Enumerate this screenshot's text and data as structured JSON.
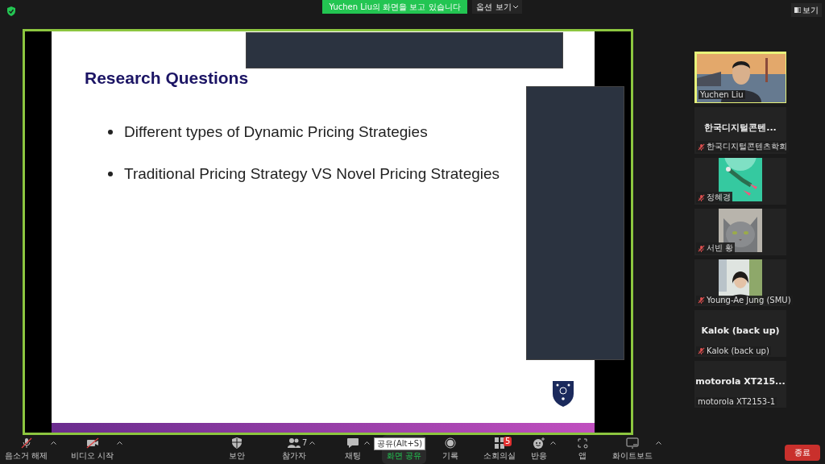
{
  "top_bar": {
    "sharing_banner": "Yuchen Liu의 화면을 보고 있습니다",
    "view_options": "옵션 보기",
    "view_button": "보기"
  },
  "shared_screen": {
    "slide": {
      "title": "Research Questions",
      "bullets": [
        "Different types of Dynamic Pricing Strategies",
        "Traditional Pricing Strategy VS Novel Pricing Strategies"
      ]
    }
  },
  "participants": [
    {
      "kind": "video",
      "name": "Yuchen Liu",
      "muted": false,
      "speaking": true
    },
    {
      "kind": "name",
      "display": "한국디지털콘텐...",
      "name": "한국디지털콘텐츠학회",
      "muted": true,
      "speaking": false
    },
    {
      "kind": "picture",
      "name": "정혜경",
      "muted": true,
      "speaking": false
    },
    {
      "kind": "picture",
      "name": "서빈 황",
      "muted": true,
      "speaking": false
    },
    {
      "kind": "picture",
      "name": "Young-Ae Jung (SMU)",
      "muted": true,
      "speaking": false
    },
    {
      "kind": "name",
      "display": "Kalok (back up)",
      "name": "Kalok (back up)",
      "muted": true,
      "speaking": false
    },
    {
      "kind": "name",
      "display": "motorola  XT215...",
      "name": "motorola XT2153-1",
      "muted": false,
      "speaking": false
    }
  ],
  "toolbar": [
    {
      "kind": "mic",
      "label": "음소거 해제",
      "off": true,
      "caret": true
    },
    {
      "kind": "video",
      "label": "비디오 시작",
      "off": true,
      "caret": true
    },
    {
      "kind": "security",
      "label": "보안",
      "caret": false
    },
    {
      "kind": "participants",
      "label": "참가자",
      "count": "7",
      "caret": true
    },
    {
      "kind": "chat",
      "label": "채팅",
      "caret": true
    },
    {
      "kind": "share",
      "label": "화면 공유",
      "tooltip": "공유(Alt+S)",
      "caret": false
    },
    {
      "kind": "record",
      "label": "기록",
      "caret": false
    },
    {
      "kind": "breakout",
      "label": "소회의실",
      "badge": "5",
      "caret": false
    },
    {
      "kind": "reactions",
      "label": "반응",
      "caret": true
    },
    {
      "kind": "apps",
      "label": "앱",
      "caret": false
    },
    {
      "kind": "whiteboard",
      "label": "화이트보드",
      "caret": true
    }
  ],
  "end_button": "종료"
}
